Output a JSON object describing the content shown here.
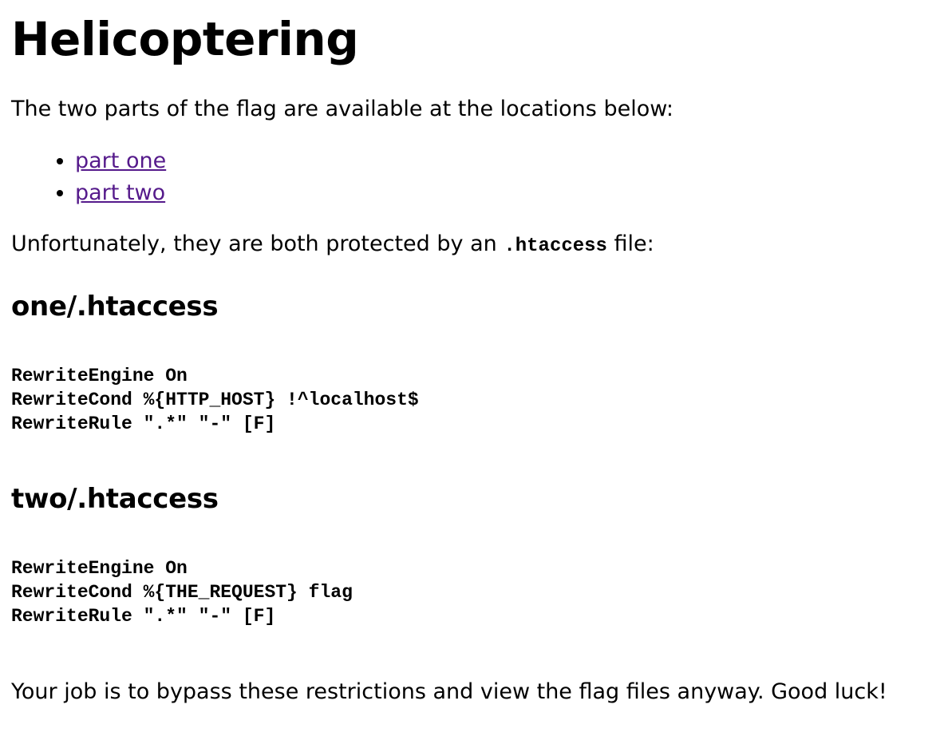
{
  "page": {
    "title": "Helicoptering",
    "intro": "The two parts of the flag are available at the locations below:",
    "links": [
      {
        "label": "part one"
      },
      {
        "label": "part two"
      }
    ],
    "protection_prefix": "Unfortunately, they are both protected by an ",
    "protection_code": ".htaccess",
    "protection_suffix": " file:",
    "sections": [
      {
        "heading": "one/.htaccess",
        "code": "RewriteEngine On\nRewriteCond %{HTTP_HOST} !^localhost$\nRewriteRule \".*\" \"-\" [F]"
      },
      {
        "heading": "two/.htaccess",
        "code": "RewriteEngine On\nRewriteCond %{THE_REQUEST} flag\nRewriteRule \".*\" \"-\" [F]"
      }
    ],
    "outro": "Your job is to bypass these restrictions and view the flag files anyway. Good luck!"
  },
  "colors": {
    "link_visited": "#551a8b",
    "text": "#000000",
    "background": "#ffffff"
  }
}
